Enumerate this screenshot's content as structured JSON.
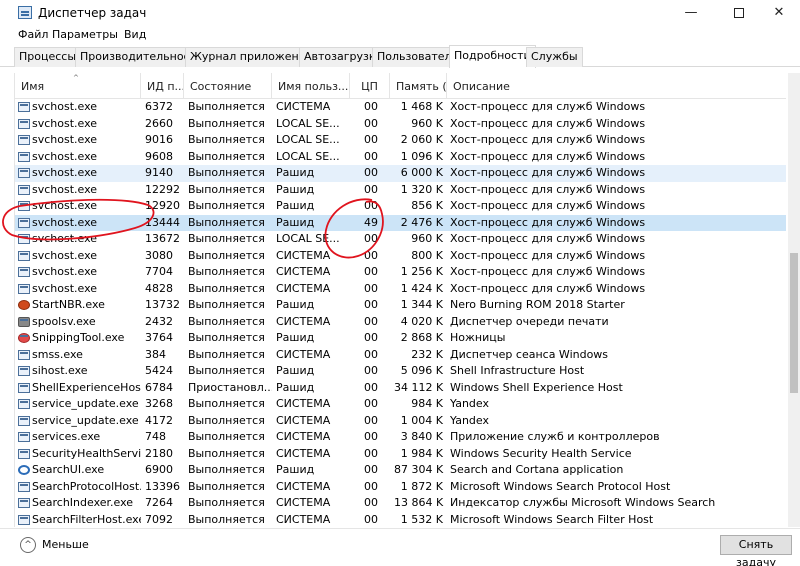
{
  "window": {
    "title": "Диспетчер задач",
    "minimize_glyph": "—",
    "close_glyph": "✕"
  },
  "menu": [
    "Файл",
    "Параметры",
    "Вид"
  ],
  "tabs": [
    "Процессы",
    "Производительность",
    "Журнал приложений",
    "Автозагрузка",
    "Пользователи",
    "Подробности",
    "Службы"
  ],
  "active_tab": "Подробности",
  "columns": [
    "Имя",
    "ИД п...",
    "Состояние",
    "Имя польз...",
    "ЦП",
    "Память (ч...",
    "Описание"
  ],
  "sort_glyph": "^",
  "rows": [
    {
      "name": "svchost.exe",
      "pid": "6372",
      "state": "Выполняется",
      "user": "СИСТЕМА",
      "cpu": "00",
      "mem": "1 468 K",
      "desc": "Хост-процесс для служб Windows",
      "icon": "service-icon"
    },
    {
      "name": "svchost.exe",
      "pid": "2660",
      "state": "Выполняется",
      "user": "LOCAL SE...",
      "cpu": "00",
      "mem": "960 K",
      "desc": "Хост-процесс для служб Windows",
      "icon": "service-icon"
    },
    {
      "name": "svchost.exe",
      "pid": "9016",
      "state": "Выполняется",
      "user": "LOCAL SE...",
      "cpu": "00",
      "mem": "2 060 K",
      "desc": "Хост-процесс для служб Windows",
      "icon": "service-icon"
    },
    {
      "name": "svchost.exe",
      "pid": "9608",
      "state": "Выполняется",
      "user": "LOCAL SE...",
      "cpu": "00",
      "mem": "1 096 K",
      "desc": "Хост-процесс для служб Windows",
      "icon": "service-icon"
    },
    {
      "name": "svchost.exe",
      "pid": "9140",
      "state": "Выполняется",
      "user": "Рашид",
      "cpu": "00",
      "mem": "6 000 K",
      "desc": "Хост-процесс для служб Windows",
      "icon": "service-icon",
      "hl": true
    },
    {
      "name": "svchost.exe",
      "pid": "12292",
      "state": "Выполняется",
      "user": "Рашид",
      "cpu": "00",
      "mem": "1 320 K",
      "desc": "Хост-процесс для служб Windows",
      "icon": "service-icon"
    },
    {
      "name": "svchost.exe",
      "pid": "12920",
      "state": "Выполняется",
      "user": "Рашид",
      "cpu": "00",
      "mem": "856 K",
      "desc": "Хост-процесс для служб Windows",
      "icon": "service-icon"
    },
    {
      "name": "svchost.exe",
      "pid": "13444",
      "state": "Выполняется",
      "user": "Рашид",
      "cpu": "49",
      "mem": "2 476 K",
      "desc": "Хост-процесс для служб Windows",
      "icon": "service-icon",
      "sel": true
    },
    {
      "name": "svchost.exe",
      "pid": "13672",
      "state": "Выполняется",
      "user": "LOCAL SE...",
      "cpu": "00",
      "mem": "960 K",
      "desc": "Хост-процесс для служб Windows",
      "icon": "service-icon"
    },
    {
      "name": "svchost.exe",
      "pid": "3080",
      "state": "Выполняется",
      "user": "СИСТЕМА",
      "cpu": "00",
      "mem": "800 K",
      "desc": "Хост-процесс для служб Windows",
      "icon": "service-icon"
    },
    {
      "name": "svchost.exe",
      "pid": "7704",
      "state": "Выполняется",
      "user": "СИСТЕМА",
      "cpu": "00",
      "mem": "1 256 K",
      "desc": "Хост-процесс для служб Windows",
      "icon": "service-icon"
    },
    {
      "name": "svchost.exe",
      "pid": "4828",
      "state": "Выполняется",
      "user": "СИСТЕМА",
      "cpu": "00",
      "mem": "1 424 K",
      "desc": "Хост-процесс для служб Windows",
      "icon": "service-icon"
    },
    {
      "name": "StartNBR.exe",
      "pid": "13732",
      "state": "Выполняется",
      "user": "Рашид",
      "cpu": "00",
      "mem": "1 344 K",
      "desc": "Nero Burning ROM 2018 Starter",
      "icon": "nero-icon"
    },
    {
      "name": "spoolsv.exe",
      "pid": "2432",
      "state": "Выполняется",
      "user": "СИСТЕМА",
      "cpu": "00",
      "mem": "4 020 K",
      "desc": "Диспетчер очереди печати",
      "icon": "printer-icon"
    },
    {
      "name": "SnippingTool.exe",
      "pid": "3764",
      "state": "Выполняется",
      "user": "Рашид",
      "cpu": "00",
      "mem": "2 868 K",
      "desc": "Ножницы",
      "icon": "scissors-icon"
    },
    {
      "name": "smss.exe",
      "pid": "384",
      "state": "Выполняется",
      "user": "СИСТЕМА",
      "cpu": "00",
      "mem": "232 K",
      "desc": "Диспетчер сеанса  Windows",
      "icon": "service-icon"
    },
    {
      "name": "sihost.exe",
      "pid": "5424",
      "state": "Выполняется",
      "user": "Рашид",
      "cpu": "00",
      "mem": "5 096 K",
      "desc": "Shell Infrastructure Host",
      "icon": "service-icon"
    },
    {
      "name": "ShellExperienceHost...",
      "pid": "6784",
      "state": "Приостановл...",
      "user": "Рашид",
      "cpu": "00",
      "mem": "34 112 K",
      "desc": "Windows Shell Experience Host",
      "icon": "service-icon"
    },
    {
      "name": "service_update.exe",
      "pid": "3268",
      "state": "Выполняется",
      "user": "СИСТЕМА",
      "cpu": "00",
      "mem": "984 K",
      "desc": "Yandex",
      "icon": "service-icon"
    },
    {
      "name": "service_update.exe",
      "pid": "4172",
      "state": "Выполняется",
      "user": "СИСТЕМА",
      "cpu": "00",
      "mem": "1 004 K",
      "desc": "Yandex",
      "icon": "service-icon"
    },
    {
      "name": "services.exe",
      "pid": "748",
      "state": "Выполняется",
      "user": "СИСТЕМА",
      "cpu": "00",
      "mem": "3 840 K",
      "desc": "Приложение служб и контроллеров",
      "icon": "service-icon"
    },
    {
      "name": "SecurityHealthServic...",
      "pid": "2180",
      "state": "Выполняется",
      "user": "СИСТЕМА",
      "cpu": "00",
      "mem": "1 984 K",
      "desc": "Windows Security Health Service",
      "icon": "service-icon"
    },
    {
      "name": "SearchUI.exe",
      "pid": "6900",
      "state": "Выполняется",
      "user": "Рашид",
      "cpu": "00",
      "mem": "87 304 K",
      "desc": "Search and Cortana application",
      "icon": "search-icon"
    },
    {
      "name": "SearchProtocolHost....",
      "pid": "13396",
      "state": "Выполняется",
      "user": "СИСТЕМА",
      "cpu": "00",
      "mem": "1 872 K",
      "desc": "Microsoft Windows Search Protocol Host",
      "icon": "service-icon"
    },
    {
      "name": "SearchIndexer.exe",
      "pid": "7264",
      "state": "Выполняется",
      "user": "СИСТЕМА",
      "cpu": "00",
      "mem": "13 864 K",
      "desc": "Индексатор службы Microsoft Windows Search",
      "icon": "service-icon"
    },
    {
      "name": "SearchFilterHost.exe",
      "pid": "7092",
      "state": "Выполняется",
      "user": "СИСТЕМА",
      "cpu": "00",
      "mem": "1 532 K",
      "desc": "Microsoft Windows Search Filter Host",
      "icon": "service-icon"
    }
  ],
  "footer": {
    "less_label": "Меньше",
    "less_glyph": "^",
    "end_task_label": "Снять задачу"
  },
  "colors": {
    "highlight_row": "#e5f0fb",
    "selected_row": "#cce4f7",
    "annotation": "#e0141e"
  }
}
